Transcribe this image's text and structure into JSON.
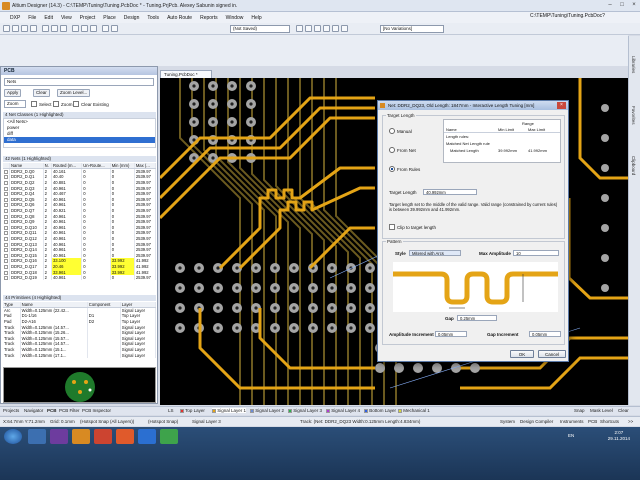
{
  "window": {
    "title": "Altium Designer (14.3) - C:\\TEMP\\Tuning\\Tuning.PcbDoc * - Tuning.PrjPcb. Alexey Sabunin signed in."
  },
  "menu": {
    "items": [
      "DXP",
      "File",
      "Edit",
      "View",
      "Project",
      "Place",
      "Design",
      "Tools",
      "Auto Route",
      "Reports",
      "Window",
      "Help"
    ],
    "path": "C:\\TEMP\\Tuning\\Tuning.PcbDoc?"
  },
  "toolbar": {
    "view_select": "(Not Saved)",
    "variant_select": "[No Variations]"
  },
  "pcb_panel": {
    "title": "PCB",
    "mode": "Nets",
    "apply": "Apply",
    "clear": "Clear",
    "zoom_level": "Zoom Level...",
    "mask_select": "Zoom",
    "chk_select": "Select",
    "chk_zoom": "Zoom",
    "chk_clear_existing": "Clear Existing",
    "classes_header": "4 Net Classes (1 Highlighted)",
    "classes": [
      "<All Nets>",
      "power",
      "diff",
      "data"
    ],
    "nets_header": "42 Nets (1 Highlighted)",
    "nets_columns": [
      "Name",
      "N.",
      "Routed (m...",
      "Un-Route...",
      "Min (mm)",
      "Max (..."
    ],
    "nets": [
      [
        "DDR2_D.Q0",
        "2",
        "40.161",
        "0",
        "0",
        "2539.97"
      ],
      [
        "DDR2_D.Q1",
        "2",
        "40.40",
        "0",
        "0",
        "2539.97"
      ],
      [
        "DDR2_D.Q2",
        "2",
        "40.881",
        "0",
        "0",
        "2539.97"
      ],
      [
        "DDR2_D.Q3",
        "2",
        "40.961",
        "0",
        "0",
        "2539.97"
      ],
      [
        "DDR2_D.Q4",
        "2",
        "40.467",
        "0",
        "0",
        "2539.97"
      ],
      [
        "DDR2_D.Q5",
        "2",
        "40.961",
        "0",
        "0",
        "2539.97"
      ],
      [
        "DDR2_D.Q6",
        "2",
        "40.961",
        "0",
        "0",
        "2539.97"
      ],
      [
        "DDR2_D.Q7",
        "2",
        "40.921",
        "0",
        "0",
        "2539.97"
      ],
      [
        "DDR2_D.Q8",
        "2",
        "40.961",
        "0",
        "0",
        "2539.97"
      ],
      [
        "DDR2_D.Q9",
        "2",
        "40.961",
        "0",
        "0",
        "2539.97"
      ],
      [
        "DDR2_D.Q10",
        "2",
        "40.961",
        "0",
        "0",
        "2539.97"
      ],
      [
        "DDR2_D.Q11",
        "2",
        "40.961",
        "0",
        "0",
        "2539.97"
      ],
      [
        "DDR2_D.Q12",
        "2",
        "40.961",
        "0",
        "0",
        "2539.97"
      ],
      [
        "DDR2_D.Q13",
        "2",
        "40.961",
        "0",
        "0",
        "2539.97"
      ],
      [
        "DDR2_D.Q14",
        "2",
        "40.961",
        "0",
        "0",
        "2539.97"
      ],
      [
        "DDR2_D.Q15",
        "2",
        "40.961",
        "0",
        "0",
        "2539.97"
      ],
      [
        "DDR2_D.Q16",
        "2",
        "33.100",
        "0",
        "33.992",
        "41.992"
      ],
      [
        "DDR2_D.Q17",
        "2",
        "20.46",
        "0",
        "33.992",
        "41.992"
      ],
      [
        "DDR2_D.Q18",
        "2",
        "33.961",
        "0",
        "33.992",
        "41.992"
      ],
      [
        "DDR2_D.Q19",
        "2",
        "40.961",
        "0",
        "0",
        "2539.97"
      ]
    ],
    "prims_header": "44 Primitives (4 Highlighted)",
    "prims_columns": [
      "Type",
      "Name",
      "Component",
      "Layer"
    ],
    "prims": [
      [
        "Arc",
        "Width=0.125mm (22.42...",
        "",
        "Signal Layer"
      ],
      [
        "Pad",
        "D1-1/16",
        "D1",
        "Top Layer"
      ],
      [
        "Pad",
        "D2-A16",
        "D2",
        "Top Layer"
      ],
      [
        "Track",
        "Width=0.125mm (14.57...",
        "",
        "Signal Layer"
      ],
      [
        "Track",
        "Width=0.125mm (15.26...",
        "",
        "Signal Layer"
      ],
      [
        "Track",
        "Width=0.125mm (15.57...",
        "",
        "Signal Layer"
      ],
      [
        "Track",
        "Width=0.125mm (14.57...",
        "",
        "Signal Layer"
      ],
      [
        "Track",
        "Width=0.125mm (15.1...",
        "",
        "Signal Layer"
      ],
      [
        "Track",
        "Width=0.125mm (17.1...",
        "",
        "Signal Layer"
      ]
    ]
  },
  "document_tab": "Tuning.PcbDoc *",
  "dialog": {
    "title": "Net: DDR2_DQ23, Old Length: 1847mm - Interactive Length Tuning [mm]",
    "target_length_group": "Target Length",
    "radio_manual": "Manual",
    "radio_from_net": "From Net",
    "radio_from_rules": "From Rules",
    "rules_table": {
      "col_name": "Name",
      "col_range": "Range",
      "col_min": "Min Limit",
      "col_max": "Max Limit",
      "row1": "Length rules:",
      "row2": "Matched Net Length rule",
      "row3_name": "Matched Length",
      "row3_min": "39.992mm",
      "row3_max": "41.992mm"
    },
    "target_length_label": "Target Length",
    "target_length_value": "40.992mm",
    "target_note": "Target length set to the middle of the valid range. Valid range (constrained by current rules) is between 39.992mm and 41.992mm.",
    "clip_to_target": "Clip to target length",
    "pattern_group": "Pattern",
    "style_label": "Style",
    "style_value": "Mitered with Arcs",
    "max_amplitude_label": "Max Amplitude",
    "max_amplitude_value": "10",
    "gap_label": "Gap",
    "gap_value": "0.25mm",
    "amplitude_increment_label": "Amplitude Increment",
    "amplitude_increment_value": "0.05mm",
    "gap_increment_label": "Gap Increment",
    "gap_increment_value": "0.05mm",
    "ok": "OK",
    "cancel": "Cancel"
  },
  "panel_tabs": [
    "Projects",
    "Navigator",
    "PCB",
    "PCB Filter",
    "PCB Inspector"
  ],
  "layer_tabs": [
    "LS",
    "Top Layer",
    "Signal Layer 1",
    "Signal Layer 2",
    "Signal Layer 3",
    "Signal Layer 4",
    "Bottom Layer",
    "Mechanical 1"
  ],
  "layer_right": [
    "Snap",
    "Mask Level",
    "Clear"
  ],
  "status": {
    "coords": "X:64.7mm Y:71.2mm",
    "grid": "Grid: 0.1mm",
    "snap": "(Hotspot Snap (All Layers))",
    "hotspot": "(Hotspot Snap)",
    "layer": "Signal Layer 3",
    "track": "Track: (Net: DDR2_DQ23 Width:0.125mm Length:4.834mm)",
    "right_items": [
      "System",
      "Design Compiler",
      "Instruments",
      "PCB",
      "Shortcuts",
      ">>"
    ]
  },
  "right_strip": [
    "Libraries",
    "Favorites",
    "Clipboard"
  ],
  "taskbar": {
    "language": "EN",
    "time": "2:07",
    "date": "29.11.2014"
  },
  "colors": {
    "trace_yellow": "#e4a416",
    "trace_dark": "#6b5a1f",
    "pad_gray": "#a5a5a5",
    "highlight_yellow": "#ffff33"
  }
}
